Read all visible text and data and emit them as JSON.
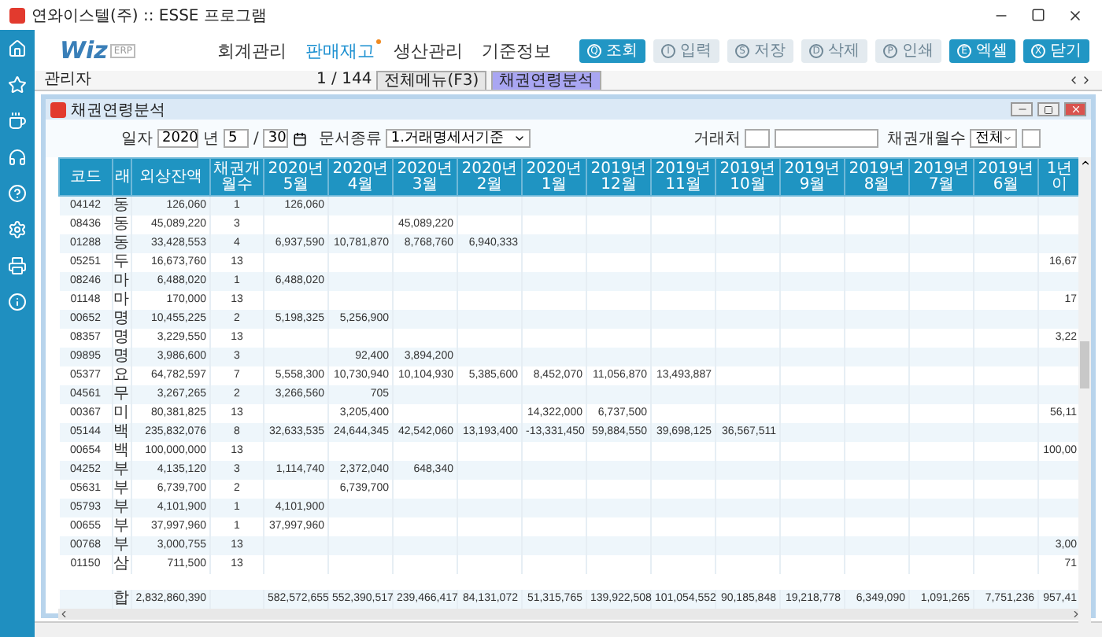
{
  "window": {
    "title": "연와이스텔(주) :: ESSE 프로그램"
  },
  "logo": {
    "text": "Wiz",
    "badge": "ERP"
  },
  "menus": [
    {
      "label": "회계관리",
      "selected": false,
      "dot": false
    },
    {
      "label": "판매재고",
      "selected": true,
      "dot": true
    },
    {
      "label": "생산관리",
      "selected": false,
      "dot": false
    },
    {
      "label": "기준정보",
      "selected": false,
      "dot": false
    }
  ],
  "buttons": [
    {
      "key": "Q",
      "label": "조회",
      "disabled": false
    },
    {
      "key": "I",
      "label": "입력",
      "disabled": true
    },
    {
      "key": "S",
      "label": "저장",
      "disabled": true
    },
    {
      "key": "D",
      "label": "삭제",
      "disabled": true
    },
    {
      "key": "P",
      "label": "인쇄",
      "disabled": true
    },
    {
      "key": "E",
      "label": "엑셀",
      "disabled": false
    },
    {
      "key": "X",
      "label": "닫기",
      "disabled": false
    }
  ],
  "tabstrip": {
    "user": "관리자",
    "counter": "1 / 144",
    "tabs": [
      {
        "label": "전체메뉴(F3)",
        "selected": false
      },
      {
        "label": "채권연령분석",
        "selected": true
      }
    ]
  },
  "panel": {
    "title": "채권연령분석"
  },
  "filters": {
    "date_label": "일자",
    "year": "2020",
    "year_unit": "년",
    "month": "5",
    "separator": "/",
    "day": "30",
    "doc_label": "문서종류",
    "doc_value": "1.거래명세서기준",
    "client_label": "거래처",
    "months_label": "채권개월수",
    "months_value": "전체"
  },
  "table": {
    "columns": [
      "코드",
      "래",
      "외상잔액",
      "채권개월수",
      "2020년 5월",
      "2020년 4월",
      "2020년 3월",
      "2020년 2월",
      "2020년 1월",
      "2019년 12월",
      "2019년 11월",
      "2019년 10월",
      "2019년 9월",
      "2019년 8월",
      "2019년 7월",
      "2019년 6월",
      "1년 이"
    ],
    "rows": [
      {
        "code": "04142",
        "name": "동",
        "balance": "126,060",
        "months": "1",
        "monthly": {
          "2020-05": "126,060"
        }
      },
      {
        "code": "08436",
        "name": "동",
        "balance": "45,089,220",
        "months": "3",
        "monthly": {
          "2020-03": "45,089,220"
        }
      },
      {
        "code": "01288",
        "name": "동",
        "balance": "33,428,553",
        "months": "4",
        "monthly": {
          "2020-05": "6,937,590",
          "2020-04": "10,781,870",
          "2020-03": "8,768,760",
          "2020-02": "6,940,333"
        }
      },
      {
        "code": "05251",
        "name": "두",
        "balance": "16,673,760",
        "months": "13",
        "over_year": "16,67"
      },
      {
        "code": "08246",
        "name": "마",
        "balance": "6,488,020",
        "months": "1",
        "monthly": {
          "2020-05": "6,488,020"
        }
      },
      {
        "code": "01148",
        "name": "마",
        "balance": "170,000",
        "months": "13",
        "over_year": "17"
      },
      {
        "code": "00652",
        "name": "명",
        "balance": "10,455,225",
        "months": "2",
        "monthly": {
          "2020-05": "5,198,325",
          "2020-04": "5,256,900"
        }
      },
      {
        "code": "08357",
        "name": "명",
        "balance": "3,229,550",
        "months": "13",
        "over_year": "3,22"
      },
      {
        "code": "09895",
        "name": "명",
        "balance": "3,986,600",
        "months": "3",
        "monthly": {
          "2020-04": "92,400",
          "2020-03": "3,894,200"
        }
      },
      {
        "code": "05377",
        "name": "요",
        "balance": "64,782,597",
        "months": "7",
        "monthly": {
          "2020-05": "5,558,300",
          "2020-04": "10,730,940",
          "2020-03": "10,104,930",
          "2020-02": "5,385,600",
          "2020-01": "8,452,070",
          "2019-12": "11,056,870",
          "2019-11": "13,493,887"
        }
      },
      {
        "code": "04561",
        "name": "무",
        "balance": "3,267,265",
        "months": "2",
        "monthly": {
          "2020-05": "3,266,560",
          "2020-04": "705"
        }
      },
      {
        "code": "00367",
        "name": "미",
        "balance": "80,381,825",
        "months": "13",
        "monthly": {
          "2020-04": "3,205,400",
          "2020-01": "14,322,000",
          "2019-12": "6,737,500"
        },
        "over_year": "56,11"
      },
      {
        "code": "05144",
        "name": "백",
        "balance": "235,832,076",
        "months": "8",
        "monthly": {
          "2020-05": "32,633,535",
          "2020-04": "24,644,345",
          "2020-03": "42,542,060",
          "2020-02": "13,193,400",
          "2020-01": "-13,331,450",
          "2019-12": "59,884,550",
          "2019-11": "39,698,125",
          "2019-10": "36,567,511"
        }
      },
      {
        "code": "00654",
        "name": "백",
        "balance": "100,000,000",
        "months": "13",
        "over_year": "100,00"
      },
      {
        "code": "04252",
        "name": "부",
        "balance": "4,135,120",
        "months": "3",
        "monthly": {
          "2020-05": "1,114,740",
          "2020-04": "2,372,040",
          "2020-03": "648,340"
        }
      },
      {
        "code": "05631",
        "name": "부",
        "balance": "6,739,700",
        "months": "2",
        "monthly": {
          "2020-04": "6,739,700"
        }
      },
      {
        "code": "05793",
        "name": "부",
        "balance": "4,101,900",
        "months": "1",
        "monthly": {
          "2020-05": "4,101,900"
        }
      },
      {
        "code": "00655",
        "name": "부",
        "balance": "37,997,960",
        "months": "1",
        "monthly": {
          "2020-05": "37,997,960"
        }
      },
      {
        "code": "00768",
        "name": "부",
        "balance": "3,000,755",
        "months": "13",
        "over_year": "3,00"
      },
      {
        "code": "01150",
        "name": "삼",
        "balance": "711,500",
        "months": "13",
        "over_year": "71"
      }
    ],
    "total": {
      "label": "합",
      "balance": "2,832,860,390",
      "monthly": [
        "582,572,655",
        "552,390,517",
        "239,466,417",
        "84,131,072",
        "51,315,765",
        "139,922,508",
        "101,054,552",
        "90,185,848",
        "19,218,778",
        "6,349,090",
        "1,091,265",
        "7,751,236"
      ],
      "over_year": "957,41"
    }
  }
}
